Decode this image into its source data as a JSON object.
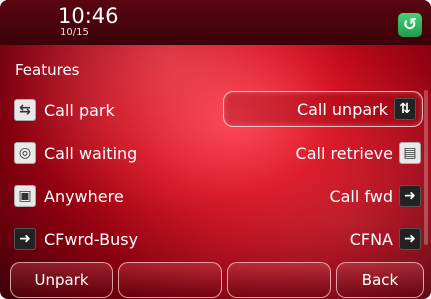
{
  "status": {
    "time": "10:46",
    "date": "10/15",
    "icon": "redial-icon"
  },
  "section_title": "Features",
  "features_left": [
    {
      "label": "Call park",
      "icon": "call-park-icon"
    },
    {
      "label": "Call waiting",
      "icon": "call-waiting-icon"
    },
    {
      "label": "Anywhere",
      "icon": "anywhere-icon"
    },
    {
      "label": "CFwrd-Busy",
      "icon": "call-forward-icon"
    }
  ],
  "features_right": [
    {
      "label": "Call unpark",
      "icon": "call-unpark-icon",
      "selected": true
    },
    {
      "label": "Call retrieve",
      "icon": "call-retrieve-icon"
    },
    {
      "label": "Call fwd",
      "icon": "call-forward-icon"
    },
    {
      "label": "CFNA",
      "icon": "call-forward-icon"
    }
  ],
  "softkeys": [
    "Unpark",
    "",
    "",
    "Back"
  ],
  "colors": {
    "background": "#c0101c",
    "accent": "#2fb25f"
  }
}
